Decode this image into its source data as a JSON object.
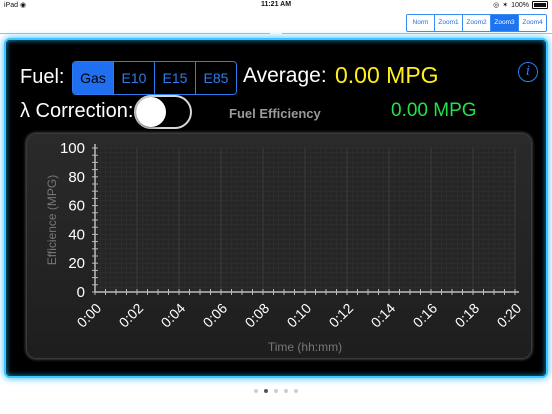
{
  "status_bar": {
    "device": "iPad",
    "time": "11:21 AM",
    "battery": "100%",
    "wifi_icon": "wifi-icon",
    "bluetooth_icon": "bluetooth-icon"
  },
  "zoom_buttons": [
    {
      "label": "Norm",
      "active": false
    },
    {
      "label": "Zoom1",
      "active": false
    },
    {
      "label": "Zoom2",
      "active": false
    },
    {
      "label": "Zoom3",
      "active": true
    },
    {
      "label": "Zoom4",
      "active": false
    }
  ],
  "fuel": {
    "label": "Fuel:",
    "options": [
      {
        "label": "Gas",
        "active": true
      },
      {
        "label": "E10",
        "active": false
      },
      {
        "label": "E15",
        "active": false
      },
      {
        "label": "E85",
        "active": false
      }
    ]
  },
  "average": {
    "label": "Average:",
    "value": "0.00 MPG",
    "value_color": "#ffef1a"
  },
  "lambda": {
    "label": "λ Correction:",
    "enabled": false
  },
  "chart_header": {
    "title": "Fuel Efficiency",
    "value": "0.00 MPG",
    "value_color": "#25e04a"
  },
  "chart_data": {
    "type": "line",
    "title": "Fuel Efficiency",
    "xlabel": "Time (hh:mm)",
    "ylabel": "Efficience (MPG)",
    "x_ticks": [
      "0:00",
      "0:02",
      "0:04",
      "0:06",
      "0:08",
      "0:10",
      "0:12",
      "0:14",
      "0:16",
      "0:18",
      "0:20"
    ],
    "y_ticks": [
      "0",
      "20",
      "40",
      "60",
      "80",
      "100"
    ],
    "ylim": [
      0,
      100
    ],
    "xlim": [
      0,
      20
    ],
    "grid": true,
    "series": [
      {
        "values": []
      }
    ]
  },
  "page_indicator": {
    "count": 5,
    "active_index": 1
  },
  "colors": {
    "panel_glow": "#36c8ff",
    "accent_blue": "#1f6ff0"
  }
}
